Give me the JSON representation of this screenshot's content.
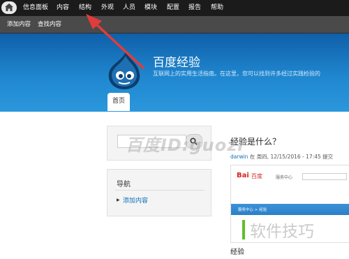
{
  "toolbar": {
    "items": [
      "信息面板",
      "内容",
      "结构",
      "外观",
      "人员",
      "模块",
      "配置",
      "报告",
      "帮助"
    ]
  },
  "shortcuts": {
    "items": [
      "添加内容",
      "查找内容"
    ]
  },
  "site": {
    "name": "百度经验",
    "slogan": "互联网上的实用生活指南。在这里，您可以找到许多经过实践检验的"
  },
  "tabs": [
    "首页"
  ],
  "sidebar": {
    "nav_title": "导航",
    "nav_link": "添加内容"
  },
  "article": {
    "title": "经验是什么？",
    "author": "darwin",
    "meta": " 在 周四, 12/15/2016 - 17:45 提交",
    "thumb_brand": "Bai",
    "thumb_brand_2": "百度",
    "thumb_service": "服务中心",
    "thumb_crumb": "服务中心 > 经验",
    "bottom_label": "经验"
  },
  "watermarks": [
    "百度ID:guozi",
    "软件技巧"
  ],
  "colors": {
    "toolbar_bg": "#1b1b1b",
    "shortcut_bg": "#4a4a4a",
    "header_blue": "#1f87cf",
    "link_blue": "#0b6fb7",
    "annotation_arrow": "#e23b3b"
  },
  "icons": [
    "home-icon",
    "search-icon",
    "drupal-logo",
    "arrow-annotation"
  ]
}
